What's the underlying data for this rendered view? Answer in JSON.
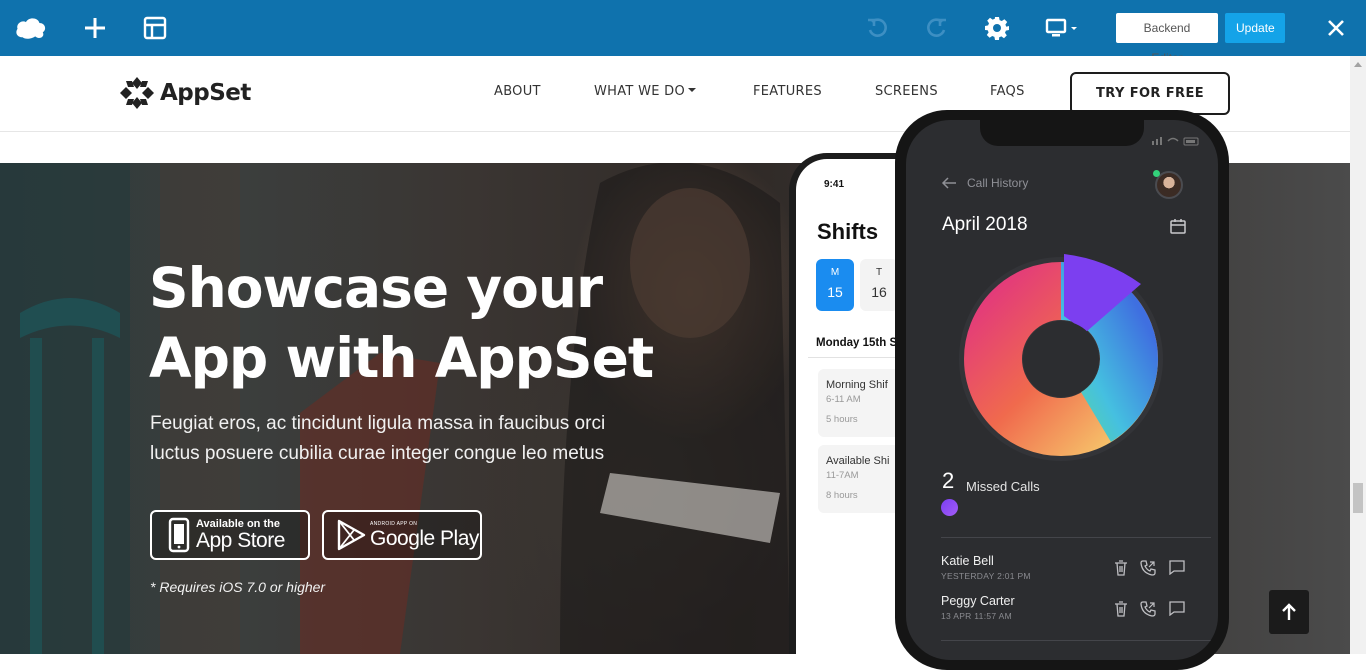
{
  "toolbar": {
    "undo_icon": "undo-icon",
    "redo_icon": "redo-icon",
    "backend_editor_label": "Backend Editor",
    "update_label": "Update",
    "accent": "#0f72ad",
    "update_color": "#14a3e8"
  },
  "site": {
    "logo_text": "AppSet",
    "nav": [
      "ABOUT",
      "WHAT WE DO",
      "FEATURES",
      "SCREENS",
      "FAQS"
    ],
    "cta_label": "TRY FOR FREE"
  },
  "hero": {
    "title_line1": "Showcase your",
    "title_line2": "App with AppSet",
    "subtitle_line1": "Feugiat eros, ac tincidunt ligula massa in faucibus orci",
    "subtitle_line2": "luctus posuere cubilia curae integer congue leo metus",
    "appstore_small": "Available on the",
    "appstore_big": "App Store",
    "googleplay_small": "ANDROID APP ON",
    "googleplay_big": "Google Play",
    "note": "* Requires iOS 7.0 or higher"
  },
  "phone_back": {
    "time": "9:41",
    "title": "Shifts",
    "days": [
      {
        "letter": "M",
        "num": "15"
      },
      {
        "letter": "T",
        "num": "16"
      }
    ],
    "date_row": "Monday 15th S",
    "shifts": [
      {
        "title": "Morning Shif",
        "range": "6-11 AM",
        "hours": "5 hours"
      },
      {
        "title": "Available Shi",
        "range": "11-7AM",
        "hours": "8 hours"
      }
    ]
  },
  "phone_front": {
    "header": "Call History",
    "month": "April 2018",
    "missed_count": "2",
    "missed_label": "Missed Calls",
    "contacts": [
      {
        "name": "Katie Bell",
        "time": "YESTERDAY 2:01 PM"
      },
      {
        "name": "Peggy Carter",
        "time": "13 APR 11:57 AM"
      }
    ]
  }
}
